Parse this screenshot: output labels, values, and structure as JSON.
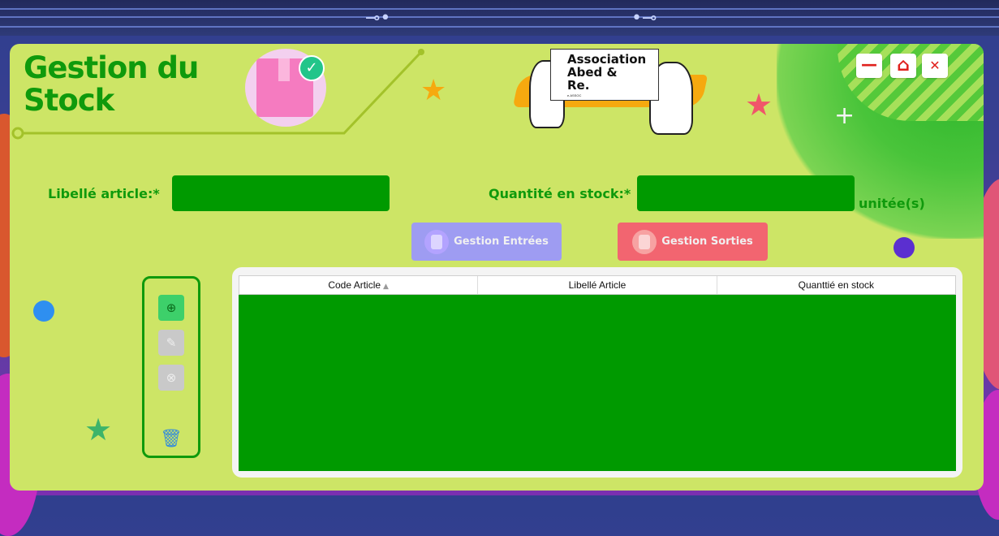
{
  "app": {
    "title_line1": "Gestion du",
    "title_line2": "Stock"
  },
  "logo": {
    "name_lines": [
      "Association",
      "Abed &",
      "Re."
    ],
    "tagline": "e.ASSOC"
  },
  "window_controls": {
    "minimize_symbol": "—",
    "home_symbol": "⌂",
    "close_symbol": "✕"
  },
  "form": {
    "libelle_label": "Libellé article:*",
    "libelle_value": "",
    "quantite_label": "Quantité en stock:*",
    "quantite_value": "",
    "unit_suffix": "unitée(s)"
  },
  "actions": {
    "entrees_label": "Gestion Entrées",
    "sorties_label": "Gestion Sorties"
  },
  "toolbar": {
    "add_symbol": "⊕",
    "edit_symbol": "✎",
    "delete_symbol": "⊗",
    "trash_symbol": "🗑"
  },
  "table": {
    "columns": [
      "Code Article",
      "Libellé Article",
      "Quanttié en stock"
    ],
    "sort_indicator": "▲",
    "rows": []
  },
  "colors": {
    "window_bg": "#cde566",
    "accent_green": "#0f9a0c",
    "field_green": "#009a00",
    "entrees_btn": "#9e9cf2",
    "sorties_btn": "#f26570",
    "close_red": "#e0211d"
  }
}
